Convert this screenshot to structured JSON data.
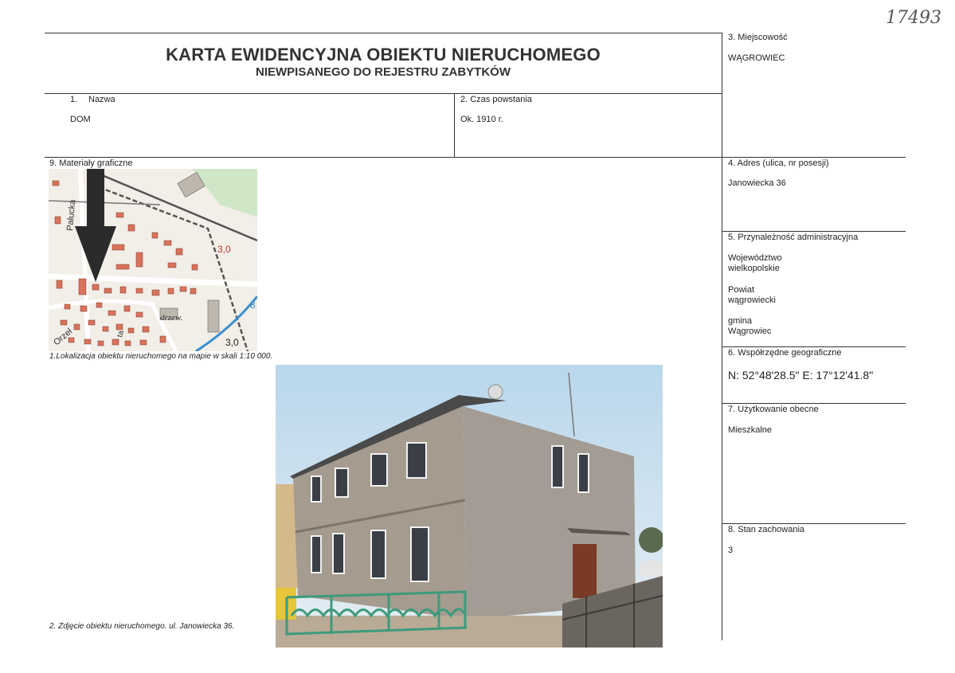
{
  "stamp": "17493",
  "header": {
    "title": "KARTA EWIDENCYJNA OBIEKTU NIERUCHOMEGO",
    "subtitle": "NIEWPISANEGO DO REJESTRU ZABYTKÓW"
  },
  "fields": {
    "name": {
      "number": "1.",
      "label": "Nazwa",
      "value": "DOM"
    },
    "built": {
      "label": "2. Czas powstania",
      "value": "Ok. 1910 r."
    },
    "locality": {
      "label": "3. Miejscowość",
      "value": "WĄGROWIEC"
    },
    "address": {
      "label": "4. Adres (ulica, nr posesji)",
      "value": "Janowiecka 36"
    },
    "admin": {
      "label": "5. Przynależność administracyjna",
      "voivodeship_label": "Województwo",
      "voivodeship": "wielkopolskie",
      "county_label": "Powiat",
      "county": "wągrowiecki",
      "commune_label": "gmina",
      "commune": "Wągrowiec"
    },
    "geo": {
      "label": "6. Współrzędne geograficzne",
      "value": "N: 52°48'28.5\"  E: 17°12'41.8\""
    },
    "usage": {
      "label": "7. Użytkowanie obecne",
      "value": "Mieszkalne"
    },
    "condition": {
      "label": "8. Stan zachowania",
      "value": "3"
    },
    "graphics": {
      "label": "9. Materiały graficzne"
    }
  },
  "map": {
    "street1": "Pałucka",
    "street2": "Orzeł",
    "street3": "ta",
    "label_drzew": "drzew.",
    "elev1": "3,0",
    "elev2": "3,0",
    "elev3": "8",
    "caption": "1.Lokalizacja obiektu nieruchomego na mapie w skali 1:10 000."
  },
  "photo": {
    "caption": "2. Zdjęcie obiektu nieruchomego. ul. Janowiecka 36."
  },
  "colors": {
    "map_bg": "#f2eee8",
    "building": "#d9735c",
    "rail": "#555555",
    "water": "#3a8fd0",
    "sky": "#cfe3f1",
    "facade": "#a9a197",
    "fence": "#3d9b7c"
  }
}
